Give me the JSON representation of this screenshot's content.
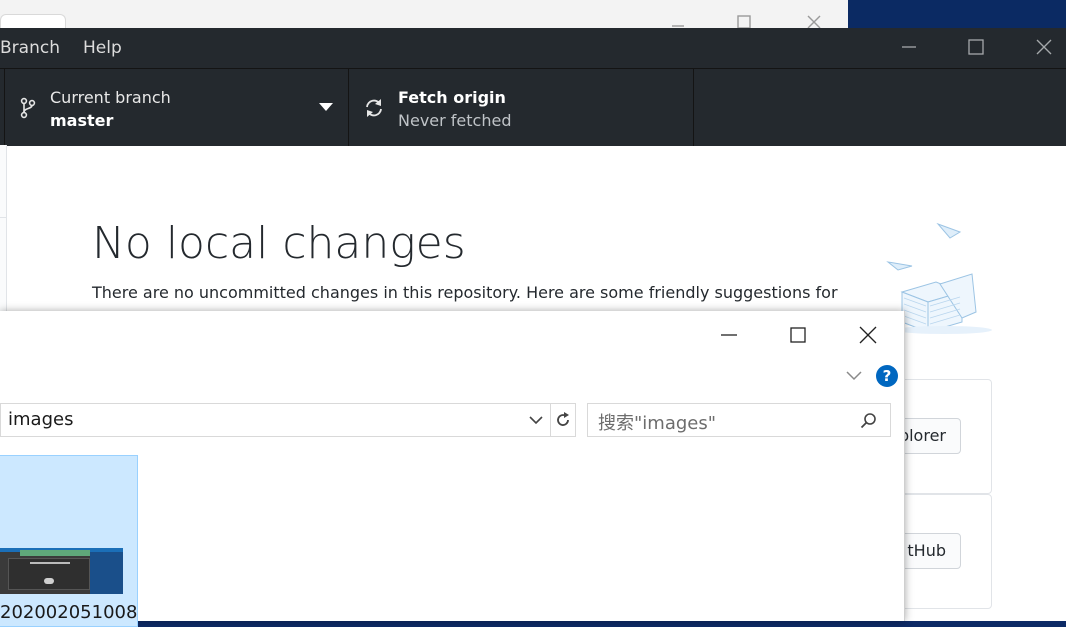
{
  "menu": {
    "branch": "Branch",
    "help": "Help"
  },
  "toolbar": {
    "current_branch_label": "Current branch",
    "current_branch_value": "master",
    "fetch_title": "Fetch origin",
    "fetch_sub": "Never fetched"
  },
  "main": {
    "title": "No local changes",
    "description": "There are no uncommitted changes in this repository. Here are some friendly suggestions for",
    "suggestion_1_button": "plorer",
    "suggestion_2_button": "tHub"
  },
  "explorer": {
    "address": "images",
    "search_placeholder": "搜索\"images\"",
    "file_name": "202002051008"
  },
  "colors": {
    "dark_bar": "#24292e",
    "selected_tile": "#cce8ff",
    "help_blue": "#0067c0"
  }
}
